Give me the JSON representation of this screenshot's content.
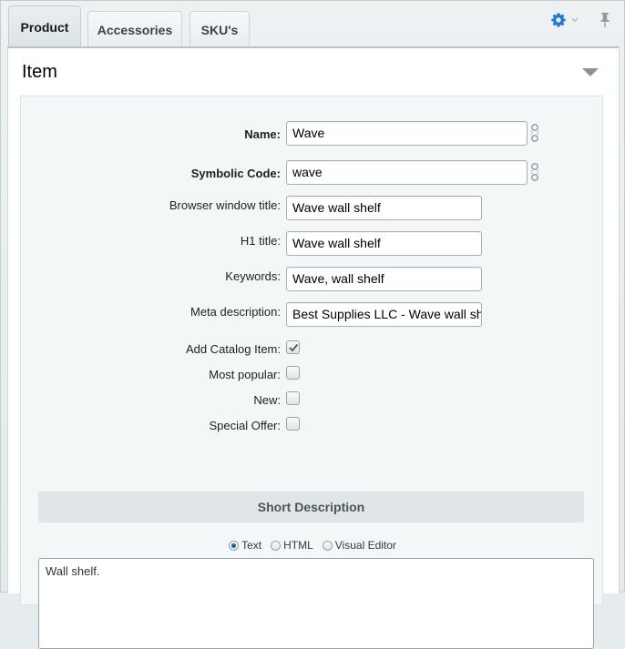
{
  "tabs": [
    {
      "label": "Product",
      "active": true
    },
    {
      "label": "Accessories",
      "active": false
    },
    {
      "label": "SKU's",
      "active": false
    }
  ],
  "toolbar": {
    "settings_icon": "gear-icon",
    "pin_icon": "pin-icon",
    "accent_color": "#1e7ad6"
  },
  "panel": {
    "title": "Item",
    "collapse_icon": "triangle-down-icon"
  },
  "form": {
    "name": {
      "label": "Name:",
      "value": "Wave"
    },
    "symbolic_code": {
      "label": "Symbolic Code:",
      "value": "wave"
    },
    "browser_title": {
      "label": "Browser window title:",
      "value": "Wave wall shelf"
    },
    "h1_title": {
      "label": "H1 title:",
      "value": "Wave wall shelf"
    },
    "keywords": {
      "label": "Keywords:",
      "value": "Wave, wall shelf"
    },
    "meta_description": {
      "label": "Meta description:",
      "value": "Best Supplies LLC - Wave wall shelf"
    },
    "add_catalog_item": {
      "label": "Add Catalog Item:",
      "checked": true
    },
    "most_popular": {
      "label": "Most popular:",
      "checked": false
    },
    "new": {
      "label": "New:",
      "checked": false
    },
    "special_offer": {
      "label": "Special Offer:",
      "checked": false
    }
  },
  "short_description": {
    "heading": "Short Description",
    "modes": [
      {
        "label": "Text",
        "selected": true
      },
      {
        "label": "HTML",
        "selected": false
      },
      {
        "label": "Visual Editor",
        "selected": false
      }
    ],
    "value": "Wall shelf."
  }
}
